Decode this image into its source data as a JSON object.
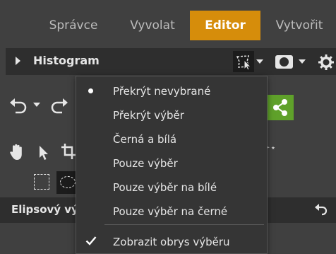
{
  "tabs": [
    {
      "label": "Správce",
      "active": false
    },
    {
      "label": "Vyvolat",
      "active": false
    },
    {
      "label": "Editor",
      "active": true
    },
    {
      "label": "Vytvořit",
      "active": false
    }
  ],
  "histogram": {
    "title": "Histogram"
  },
  "ellipse_panel": {
    "title": "Elipsový výběr"
  },
  "menu": {
    "items": [
      {
        "label": "Překrýt nevybrané",
        "selected": true
      },
      {
        "label": "Překrýt výběr",
        "selected": false
      },
      {
        "label": "Černá a bílá",
        "selected": false
      },
      {
        "label": "Pouze výběr",
        "selected": false
      },
      {
        "label": "Pouze výběr na bílé",
        "selected": false
      },
      {
        "label": "Pouze výběr na černé",
        "selected": false
      }
    ],
    "toggle": {
      "label": "Zobrazit obrys výběru",
      "checked": true
    }
  },
  "colors": {
    "accent": "#d68d0b",
    "share_green": "#5fa12a",
    "background": "#404040",
    "panel": "#2e2e2e",
    "menu": "#353535"
  },
  "icons": [
    "selection-overlay-icon",
    "mask-icon",
    "gear-icon",
    "undo-icon",
    "redo-icon",
    "share-icon",
    "hand-icon",
    "arrow-icon",
    "crop-icon",
    "rect-select-icon",
    "ellipse-select-icon",
    "reset-icon",
    "check-icon",
    "bullet-icon"
  ]
}
